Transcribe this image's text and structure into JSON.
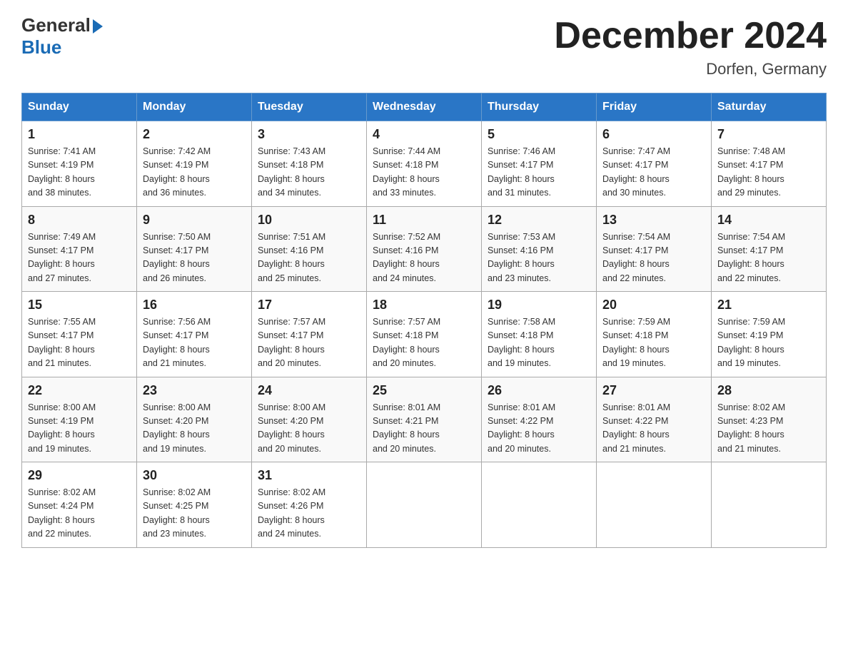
{
  "header": {
    "logo_general": "General",
    "logo_blue": "Blue",
    "month_title": "December 2024",
    "location": "Dorfen, Germany"
  },
  "weekdays": [
    "Sunday",
    "Monday",
    "Tuesday",
    "Wednesday",
    "Thursday",
    "Friday",
    "Saturday"
  ],
  "weeks": [
    [
      {
        "day": "1",
        "sunrise": "7:41 AM",
        "sunset": "4:19 PM",
        "daylight": "8 hours and 38 minutes."
      },
      {
        "day": "2",
        "sunrise": "7:42 AM",
        "sunset": "4:19 PM",
        "daylight": "8 hours and 36 minutes."
      },
      {
        "day": "3",
        "sunrise": "7:43 AM",
        "sunset": "4:18 PM",
        "daylight": "8 hours and 34 minutes."
      },
      {
        "day": "4",
        "sunrise": "7:44 AM",
        "sunset": "4:18 PM",
        "daylight": "8 hours and 33 minutes."
      },
      {
        "day": "5",
        "sunrise": "7:46 AM",
        "sunset": "4:17 PM",
        "daylight": "8 hours and 31 minutes."
      },
      {
        "day": "6",
        "sunrise": "7:47 AM",
        "sunset": "4:17 PM",
        "daylight": "8 hours and 30 minutes."
      },
      {
        "day": "7",
        "sunrise": "7:48 AM",
        "sunset": "4:17 PM",
        "daylight": "8 hours and 29 minutes."
      }
    ],
    [
      {
        "day": "8",
        "sunrise": "7:49 AM",
        "sunset": "4:17 PM",
        "daylight": "8 hours and 27 minutes."
      },
      {
        "day": "9",
        "sunrise": "7:50 AM",
        "sunset": "4:17 PM",
        "daylight": "8 hours and 26 minutes."
      },
      {
        "day": "10",
        "sunrise": "7:51 AM",
        "sunset": "4:16 PM",
        "daylight": "8 hours and 25 minutes."
      },
      {
        "day": "11",
        "sunrise": "7:52 AM",
        "sunset": "4:16 PM",
        "daylight": "8 hours and 24 minutes."
      },
      {
        "day": "12",
        "sunrise": "7:53 AM",
        "sunset": "4:16 PM",
        "daylight": "8 hours and 23 minutes."
      },
      {
        "day": "13",
        "sunrise": "7:54 AM",
        "sunset": "4:17 PM",
        "daylight": "8 hours and 22 minutes."
      },
      {
        "day": "14",
        "sunrise": "7:54 AM",
        "sunset": "4:17 PM",
        "daylight": "8 hours and 22 minutes."
      }
    ],
    [
      {
        "day": "15",
        "sunrise": "7:55 AM",
        "sunset": "4:17 PM",
        "daylight": "8 hours and 21 minutes."
      },
      {
        "day": "16",
        "sunrise": "7:56 AM",
        "sunset": "4:17 PM",
        "daylight": "8 hours and 21 minutes."
      },
      {
        "day": "17",
        "sunrise": "7:57 AM",
        "sunset": "4:17 PM",
        "daylight": "8 hours and 20 minutes."
      },
      {
        "day": "18",
        "sunrise": "7:57 AM",
        "sunset": "4:18 PM",
        "daylight": "8 hours and 20 minutes."
      },
      {
        "day": "19",
        "sunrise": "7:58 AM",
        "sunset": "4:18 PM",
        "daylight": "8 hours and 19 minutes."
      },
      {
        "day": "20",
        "sunrise": "7:59 AM",
        "sunset": "4:18 PM",
        "daylight": "8 hours and 19 minutes."
      },
      {
        "day": "21",
        "sunrise": "7:59 AM",
        "sunset": "4:19 PM",
        "daylight": "8 hours and 19 minutes."
      }
    ],
    [
      {
        "day": "22",
        "sunrise": "8:00 AM",
        "sunset": "4:19 PM",
        "daylight": "8 hours and 19 minutes."
      },
      {
        "day": "23",
        "sunrise": "8:00 AM",
        "sunset": "4:20 PM",
        "daylight": "8 hours and 19 minutes."
      },
      {
        "day": "24",
        "sunrise": "8:00 AM",
        "sunset": "4:20 PM",
        "daylight": "8 hours and 20 minutes."
      },
      {
        "day": "25",
        "sunrise": "8:01 AM",
        "sunset": "4:21 PM",
        "daylight": "8 hours and 20 minutes."
      },
      {
        "day": "26",
        "sunrise": "8:01 AM",
        "sunset": "4:22 PM",
        "daylight": "8 hours and 20 minutes."
      },
      {
        "day": "27",
        "sunrise": "8:01 AM",
        "sunset": "4:22 PM",
        "daylight": "8 hours and 21 minutes."
      },
      {
        "day": "28",
        "sunrise": "8:02 AM",
        "sunset": "4:23 PM",
        "daylight": "8 hours and 21 minutes."
      }
    ],
    [
      {
        "day": "29",
        "sunrise": "8:02 AM",
        "sunset": "4:24 PM",
        "daylight": "8 hours and 22 minutes."
      },
      {
        "day": "30",
        "sunrise": "8:02 AM",
        "sunset": "4:25 PM",
        "daylight": "8 hours and 23 minutes."
      },
      {
        "day": "31",
        "sunrise": "8:02 AM",
        "sunset": "4:26 PM",
        "daylight": "8 hours and 24 minutes."
      },
      null,
      null,
      null,
      null
    ]
  ],
  "labels": {
    "sunrise": "Sunrise:",
    "sunset": "Sunset:",
    "daylight": "Daylight:"
  }
}
